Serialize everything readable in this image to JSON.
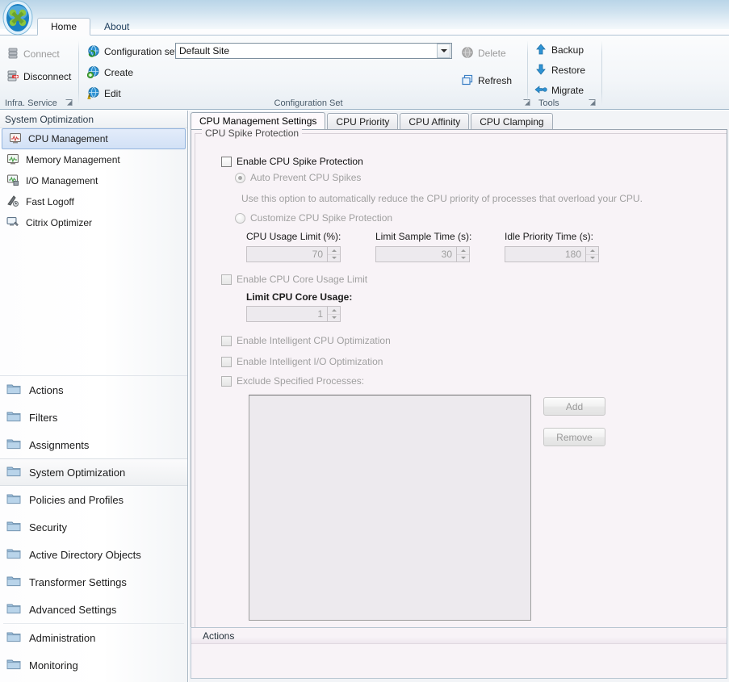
{
  "window": {
    "app_icon": "citrix-logo-icon"
  },
  "ribbon": {
    "tabs": [
      {
        "label": "Home",
        "active": true
      },
      {
        "label": "About",
        "active": false
      }
    ],
    "groups": {
      "infra_service": {
        "label": "Infra. Service",
        "items": [
          {
            "label": "Connect",
            "icon": "server-connect-icon",
            "disabled": true
          },
          {
            "label": "Disconnect",
            "icon": "server-disconnect-icon",
            "disabled": false
          }
        ],
        "launcher": "dialog-launcher-icon"
      },
      "configuration_set": {
        "label": "Configuration Set",
        "combo_label": "Configuration set",
        "combo_value": "Default Site",
        "combo_icon": "globe-refresh-icon",
        "items": [
          {
            "label": "Create",
            "icon": "globe-add-icon",
            "disabled": false
          },
          {
            "label": "Edit",
            "icon": "globe-warning-icon",
            "disabled": false
          },
          {
            "label": "Delete",
            "icon": "globe-delete-icon",
            "disabled": true
          },
          {
            "label": "Refresh",
            "icon": "refresh-windows-icon",
            "disabled": false
          }
        ],
        "launcher": "dialog-launcher-icon"
      },
      "tools": {
        "label": "Tools",
        "items": [
          {
            "label": "Backup",
            "icon": "backup-up-arrow-icon",
            "disabled": false
          },
          {
            "label": "Restore",
            "icon": "restore-down-arrow-icon",
            "disabled": false
          },
          {
            "label": "Migrate",
            "icon": "migrate-arrows-icon",
            "disabled": false
          }
        ],
        "launcher": "dialog-launcher-icon"
      }
    }
  },
  "sidebar": {
    "header": "System Optimization",
    "items": [
      {
        "label": "CPU Management",
        "icon": "cpu-chart-icon",
        "selected": true
      },
      {
        "label": "Memory Management",
        "icon": "memory-chart-icon",
        "selected": false
      },
      {
        "label": "I/O Management",
        "icon": "io-chart-icon",
        "selected": false
      },
      {
        "label": "Fast Logoff",
        "icon": "fast-logoff-icon",
        "selected": false
      },
      {
        "label": "Citrix Optimizer",
        "icon": "citrix-optimizer-icon",
        "selected": false
      }
    ],
    "nav": [
      {
        "label": "Actions",
        "icon": "folder-icon",
        "selected": false
      },
      {
        "label": "Filters",
        "icon": "folder-icon",
        "selected": false
      },
      {
        "label": "Assignments",
        "icon": "folder-icon",
        "selected": false
      },
      {
        "label": "System Optimization",
        "icon": "folder-icon",
        "selected": true
      },
      {
        "label": "Policies and Profiles",
        "icon": "folder-icon",
        "selected": false
      },
      {
        "label": "Security",
        "icon": "folder-icon",
        "selected": false
      },
      {
        "label": "Active Directory Objects",
        "icon": "folder-icon",
        "selected": false
      },
      {
        "label": "Transformer Settings",
        "icon": "folder-icon",
        "selected": false
      },
      {
        "label": "Advanced Settings",
        "icon": "folder-icon",
        "selected": false
      },
      {
        "label": "Administration",
        "icon": "folder-icon",
        "selected": false
      },
      {
        "label": "Monitoring",
        "icon": "folder-icon",
        "selected": false
      }
    ]
  },
  "main": {
    "tabs": [
      {
        "label": "CPU Management Settings",
        "active": true
      },
      {
        "label": "CPU Priority",
        "active": false
      },
      {
        "label": "CPU Affinity",
        "active": false
      },
      {
        "label": "CPU Clamping",
        "active": false
      }
    ],
    "group_title": "CPU Spike Protection",
    "enable_spike_protection": {
      "label": "Enable CPU Spike Protection",
      "checked": false,
      "disabled": false
    },
    "auto_prevent": {
      "label": "Auto Prevent CPU Spikes",
      "checked": true,
      "disabled": true
    },
    "auto_prevent_hint": "Use this option to automatically reduce the CPU priority of processes that overload your CPU.",
    "customize": {
      "label": "Customize CPU Spike Protection",
      "checked": false,
      "disabled": true
    },
    "fields": [
      {
        "label": "CPU Usage Limit (%):",
        "value": "70",
        "disabled": true
      },
      {
        "label": "Limit Sample Time (s):",
        "value": "30",
        "disabled": true
      },
      {
        "label": "Idle Priority Time (s):",
        "value": "180",
        "disabled": true
      }
    ],
    "enable_core_limit": {
      "label": "Enable CPU Core Usage Limit",
      "checked": false,
      "disabled": true
    },
    "core_usage_field": {
      "label": "Limit CPU Core Usage:",
      "value": "1",
      "disabled": true
    },
    "enable_intelligent_cpu": {
      "label": "Enable Intelligent CPU Optimization",
      "checked": false,
      "disabled": true
    },
    "enable_intelligent_io": {
      "label": "Enable Intelligent I/O Optimization",
      "checked": false,
      "disabled": true
    },
    "exclude_processes": {
      "label": "Exclude Specified Processes:",
      "checked": false,
      "disabled": true
    },
    "process_list_items": [],
    "add_button": "Add",
    "remove_button": "Remove",
    "actions_panel_title": "Actions"
  },
  "colors": {
    "titlebar_top": "#b9d5e8",
    "content_bg": "#f8f3f7",
    "listbox_bg": "#edeaee",
    "selection_blue": "#d2e1f6",
    "disabled_text": "#a0a0a0"
  }
}
